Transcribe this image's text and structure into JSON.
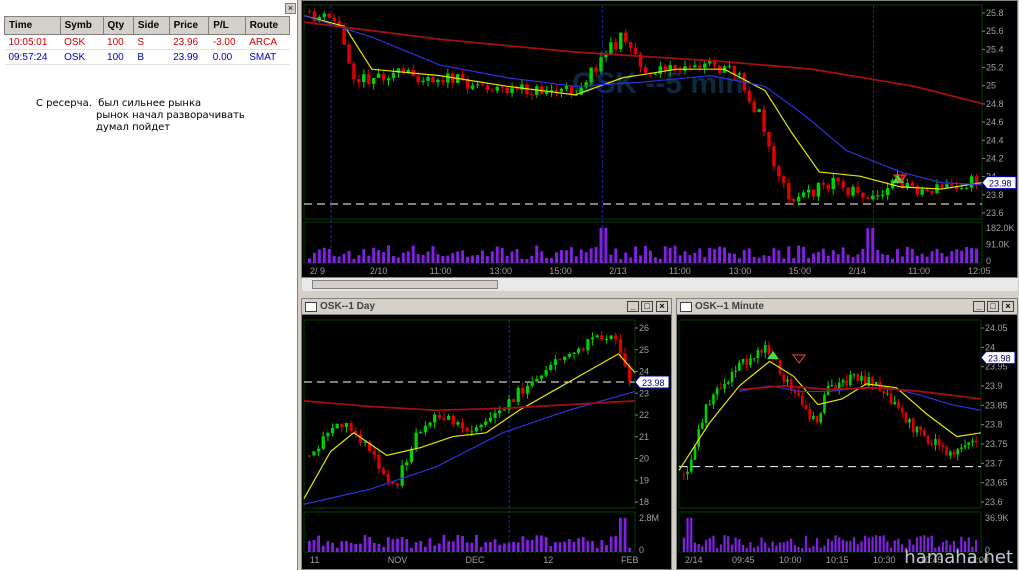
{
  "trades": {
    "headers": [
      "Time",
      "Symb",
      "Qty",
      "Side",
      "Price",
      "P/L",
      "Route"
    ],
    "rows": [
      {
        "time": "10:05:01",
        "symb": "OSK",
        "qty": "100",
        "side": "S",
        "price": "23.96",
        "pl": "-3.00",
        "route": "ARCA"
      },
      {
        "time": "09:57:24",
        "symb": "OSK",
        "qty": "100",
        "side": "B",
        "price": "23.99",
        "pl": "0.00",
        "route": "SMAT"
      }
    ]
  },
  "note": {
    "line1_a": "С ресерча.",
    "line1_b": "был сильнее рынка",
    "line2": "рынок начал разворачивать",
    "line3": "думал пойдет"
  },
  "main_chart": {
    "watermark": "OSK --5 min",
    "y_ticks": [
      "25.8",
      "25.6",
      "25.4",
      "25.2",
      "25",
      "24.8",
      "24.6",
      "24.4",
      "24.2",
      "24",
      "23.8",
      "23.6"
    ],
    "price_tag": "23.98",
    "vol_ticks": [
      "182.0K",
      "91.0K",
      "0"
    ],
    "x_ticks": [
      "2/ 9",
      "2/10",
      "11:00",
      "13:00",
      "15:00",
      "2/13",
      "11:00",
      "13:00",
      "15:00",
      "2/14",
      "11:00",
      "12:05"
    ]
  },
  "day_chart": {
    "title": "OSK--1 Day",
    "y_ticks": [
      "26",
      "25",
      "24",
      "23",
      "22",
      "21",
      "20",
      "19",
      "18"
    ],
    "price_tag": "23.98",
    "vol_ticks": [
      "2.8M",
      "0"
    ],
    "x_ticks": [
      "11",
      "NOV",
      "DEC",
      "12",
      "FEB"
    ]
  },
  "minute_chart": {
    "title": "OSK--1 Minute",
    "y_ticks": [
      "24.05",
      "24",
      "23.95",
      "23.9",
      "23.85",
      "23.8",
      "23.75",
      "23.7",
      "23.65",
      "23.6"
    ],
    "price_tag": "23.98",
    "vol_ticks": [
      "36.9K",
      "0"
    ],
    "x_ticks": [
      "2/14",
      "09:45",
      "10:00",
      "10:15",
      "10:30",
      "10:45",
      "11:00"
    ]
  },
  "window_buttons": {
    "min": "_",
    "max": "□",
    "close": "×"
  },
  "watermark": "hamaha.net",
  "colors": {
    "up": "#00d000",
    "down": "#e00000",
    "ma_fast": "#e6e600",
    "ma_mid": "#3030e0",
    "ma_slow": "#a01010",
    "volume": "#8020e0",
    "grid": "#003000",
    "axis_text": "#a0a0a0"
  }
}
